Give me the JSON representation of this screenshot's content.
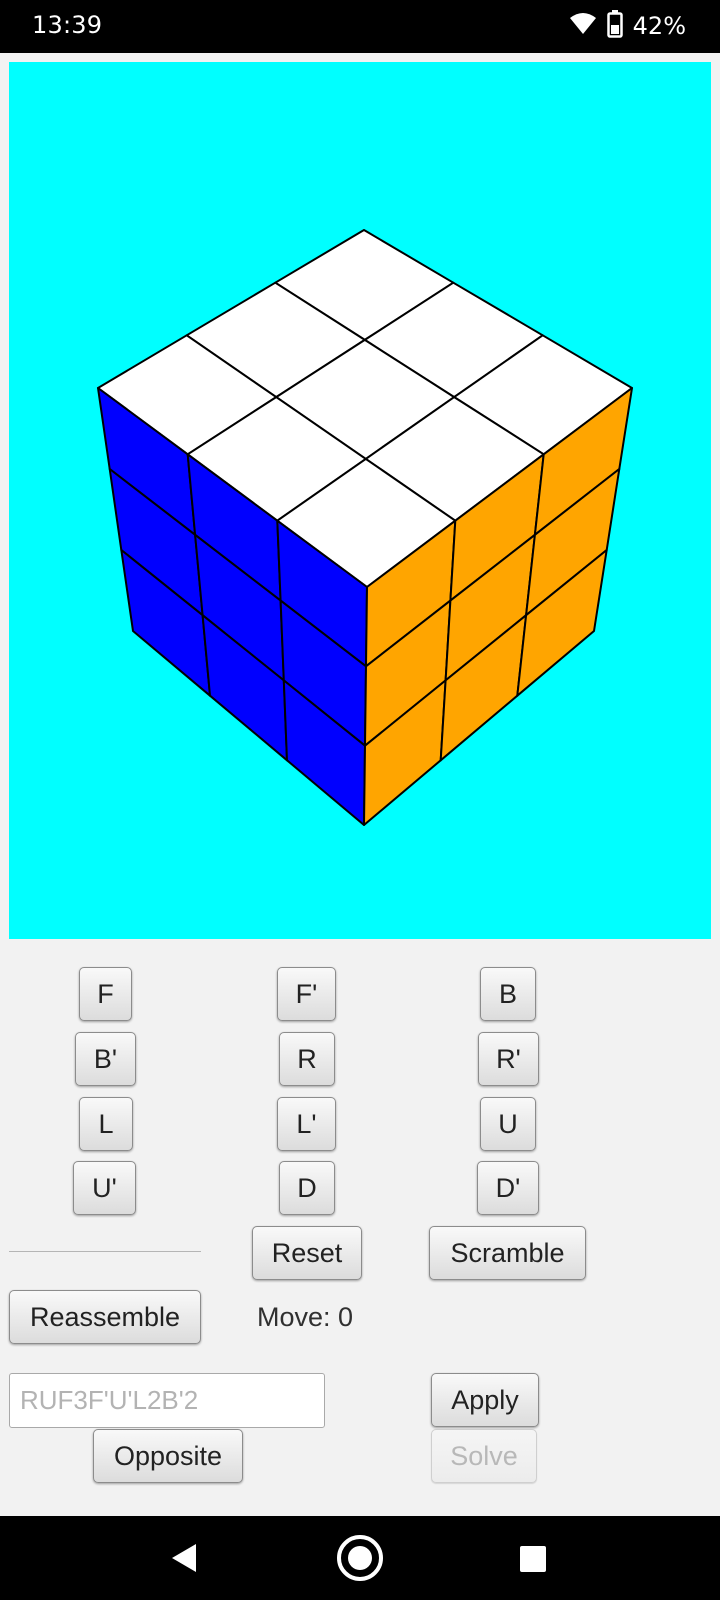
{
  "status_bar": {
    "time": "13:39",
    "battery": "42%",
    "icons": [
      "wifi-icon",
      "battery-icon"
    ]
  },
  "cube": {
    "background_color": "#00ffff",
    "faces": {
      "top": [
        "#ffffff",
        "#ffffff",
        "#ffffff",
        "#ffffff",
        "#ffffff",
        "#ffffff",
        "#ffffff",
        "#ffffff",
        "#ffffff"
      ],
      "left": [
        "#0000ff",
        "#0000ff",
        "#0000ff",
        "#0000ff",
        "#0000ff",
        "#0000ff",
        "#0000ff",
        "#0000ff",
        "#0000ff"
      ],
      "right": [
        "#ffa500",
        "#ffa500",
        "#ffa500",
        "#ffa500",
        "#ffa500",
        "#ffa500",
        "#ffa500",
        "#ffa500",
        "#ffa500"
      ]
    }
  },
  "move_buttons": {
    "f": "F",
    "f_prime": "F'",
    "b": "B",
    "b_prime": "B'",
    "r": "R",
    "r_prime": "R'",
    "l": "L",
    "l_prime": "L'",
    "u": "U",
    "u_prime": "U'",
    "d": "D",
    "d_prime": "D'"
  },
  "controls": {
    "reset": "Reset",
    "scramble": "Scramble",
    "reassemble": "Reassemble",
    "move_counter": "Move: 0",
    "sequence_placeholder": "RUF3F'U'L2B'2",
    "sequence_value": "",
    "apply": "Apply",
    "opposite": "Opposite",
    "solve": "Solve"
  },
  "nav_bar": {
    "icons": [
      "back-icon",
      "home-icon",
      "recents-icon"
    ]
  }
}
